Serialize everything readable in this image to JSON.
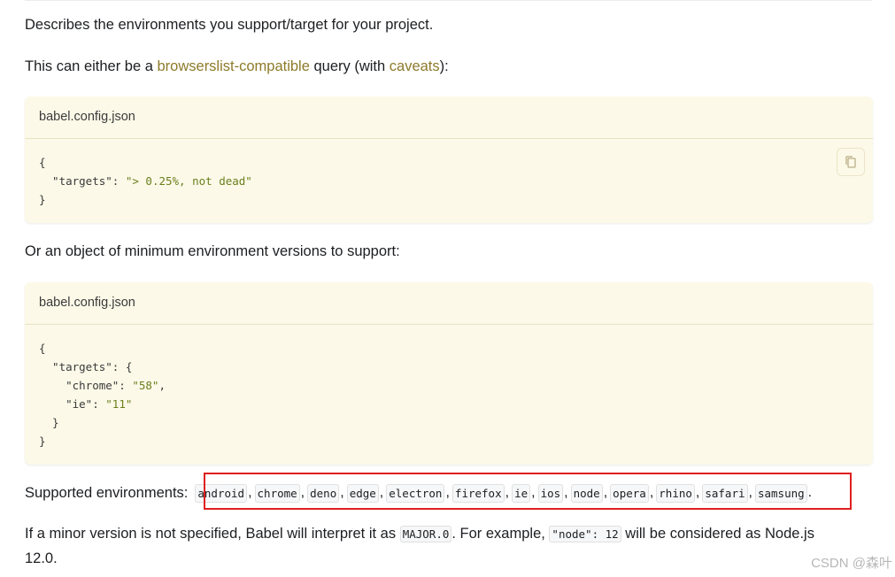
{
  "intro": "Describes the environments you support/target for your project.",
  "either": {
    "prefix": "This can either be a ",
    "link1": "browserslist-compatible",
    "mid": " query (with ",
    "link2": "caveats",
    "suffix": "):"
  },
  "code1": {
    "title": "babel.config.json",
    "lines": [
      "{",
      "  \"targets\": ",
      "\"> 0.25%, not dead\"",
      "}"
    ]
  },
  "object_text": "Or an object of minimum environment versions to support:",
  "code2": {
    "title": "babel.config.json",
    "l1": "{",
    "l2": "  \"targets\": {",
    "l3_key": "    \"chrome\": ",
    "l3_val": "\"58\"",
    "l3_end": ",",
    "l4_key": "    \"ie\": ",
    "l4_val": "\"11\"",
    "l5": "  }",
    "l6": "}"
  },
  "supported": {
    "label": "Supported environments:",
    "envs": [
      "android",
      "chrome",
      "deno",
      "edge",
      "electron",
      "firefox",
      "ie",
      "ios",
      "node",
      "opera",
      "rhino",
      "safari",
      "samsung"
    ]
  },
  "minor": {
    "prefix": "If a minor version is not specified, Babel will interpret it as ",
    "code1": "MAJOR.0",
    "mid": ". For example, ",
    "code2": "\"node\": 12",
    "suffix": " will be considered as Node.js",
    "line2": "12.0."
  },
  "watermark": "CSDN @森叶",
  "colors": {
    "link": "#8d7a2a",
    "code_bg": "#fcf9e8",
    "highlight": "#e01f1f"
  },
  "icons": {
    "copy": "copy-icon"
  }
}
